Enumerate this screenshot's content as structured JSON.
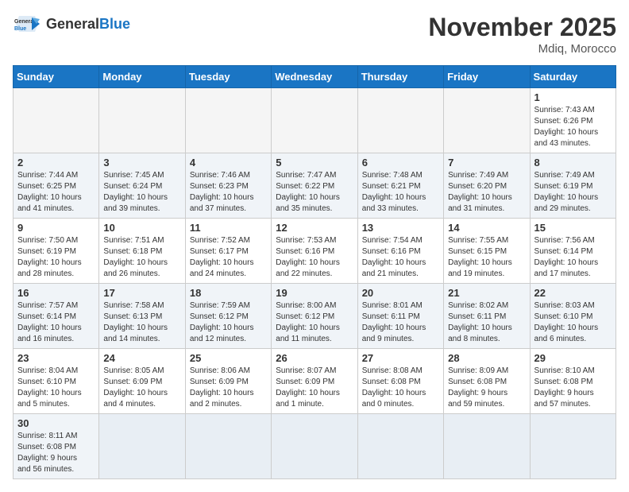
{
  "header": {
    "logo_general": "General",
    "logo_blue": "Blue",
    "month_title": "November 2025",
    "subtitle": "Mdiq, Morocco"
  },
  "weekdays": [
    "Sunday",
    "Monday",
    "Tuesday",
    "Wednesday",
    "Thursday",
    "Friday",
    "Saturday"
  ],
  "weeks": [
    [
      {
        "day": "",
        "info": ""
      },
      {
        "day": "",
        "info": ""
      },
      {
        "day": "",
        "info": ""
      },
      {
        "day": "",
        "info": ""
      },
      {
        "day": "",
        "info": ""
      },
      {
        "day": "",
        "info": ""
      },
      {
        "day": "1",
        "info": "Sunrise: 7:43 AM\nSunset: 6:26 PM\nDaylight: 10 hours\nand 43 minutes."
      }
    ],
    [
      {
        "day": "2",
        "info": "Sunrise: 7:44 AM\nSunset: 6:25 PM\nDaylight: 10 hours\nand 41 minutes."
      },
      {
        "day": "3",
        "info": "Sunrise: 7:45 AM\nSunset: 6:24 PM\nDaylight: 10 hours\nand 39 minutes."
      },
      {
        "day": "4",
        "info": "Sunrise: 7:46 AM\nSunset: 6:23 PM\nDaylight: 10 hours\nand 37 minutes."
      },
      {
        "day": "5",
        "info": "Sunrise: 7:47 AM\nSunset: 6:22 PM\nDaylight: 10 hours\nand 35 minutes."
      },
      {
        "day": "6",
        "info": "Sunrise: 7:48 AM\nSunset: 6:21 PM\nDaylight: 10 hours\nand 33 minutes."
      },
      {
        "day": "7",
        "info": "Sunrise: 7:49 AM\nSunset: 6:20 PM\nDaylight: 10 hours\nand 31 minutes."
      },
      {
        "day": "8",
        "info": "Sunrise: 7:49 AM\nSunset: 6:19 PM\nDaylight: 10 hours\nand 29 minutes."
      }
    ],
    [
      {
        "day": "9",
        "info": "Sunrise: 7:50 AM\nSunset: 6:19 PM\nDaylight: 10 hours\nand 28 minutes."
      },
      {
        "day": "10",
        "info": "Sunrise: 7:51 AM\nSunset: 6:18 PM\nDaylight: 10 hours\nand 26 minutes."
      },
      {
        "day": "11",
        "info": "Sunrise: 7:52 AM\nSunset: 6:17 PM\nDaylight: 10 hours\nand 24 minutes."
      },
      {
        "day": "12",
        "info": "Sunrise: 7:53 AM\nSunset: 6:16 PM\nDaylight: 10 hours\nand 22 minutes."
      },
      {
        "day": "13",
        "info": "Sunrise: 7:54 AM\nSunset: 6:16 PM\nDaylight: 10 hours\nand 21 minutes."
      },
      {
        "day": "14",
        "info": "Sunrise: 7:55 AM\nSunset: 6:15 PM\nDaylight: 10 hours\nand 19 minutes."
      },
      {
        "day": "15",
        "info": "Sunrise: 7:56 AM\nSunset: 6:14 PM\nDaylight: 10 hours\nand 17 minutes."
      }
    ],
    [
      {
        "day": "16",
        "info": "Sunrise: 7:57 AM\nSunset: 6:14 PM\nDaylight: 10 hours\nand 16 minutes."
      },
      {
        "day": "17",
        "info": "Sunrise: 7:58 AM\nSunset: 6:13 PM\nDaylight: 10 hours\nand 14 minutes."
      },
      {
        "day": "18",
        "info": "Sunrise: 7:59 AM\nSunset: 6:12 PM\nDaylight: 10 hours\nand 12 minutes."
      },
      {
        "day": "19",
        "info": "Sunrise: 8:00 AM\nSunset: 6:12 PM\nDaylight: 10 hours\nand 11 minutes."
      },
      {
        "day": "20",
        "info": "Sunrise: 8:01 AM\nSunset: 6:11 PM\nDaylight: 10 hours\nand 9 minutes."
      },
      {
        "day": "21",
        "info": "Sunrise: 8:02 AM\nSunset: 6:11 PM\nDaylight: 10 hours\nand 8 minutes."
      },
      {
        "day": "22",
        "info": "Sunrise: 8:03 AM\nSunset: 6:10 PM\nDaylight: 10 hours\nand 6 minutes."
      }
    ],
    [
      {
        "day": "23",
        "info": "Sunrise: 8:04 AM\nSunset: 6:10 PM\nDaylight: 10 hours\nand 5 minutes."
      },
      {
        "day": "24",
        "info": "Sunrise: 8:05 AM\nSunset: 6:09 PM\nDaylight: 10 hours\nand 4 minutes."
      },
      {
        "day": "25",
        "info": "Sunrise: 8:06 AM\nSunset: 6:09 PM\nDaylight: 10 hours\nand 2 minutes."
      },
      {
        "day": "26",
        "info": "Sunrise: 8:07 AM\nSunset: 6:09 PM\nDaylight: 10 hours\nand 1 minute."
      },
      {
        "day": "27",
        "info": "Sunrise: 8:08 AM\nSunset: 6:08 PM\nDaylight: 10 hours\nand 0 minutes."
      },
      {
        "day": "28",
        "info": "Sunrise: 8:09 AM\nSunset: 6:08 PM\nDaylight: 9 hours\nand 59 minutes."
      },
      {
        "day": "29",
        "info": "Sunrise: 8:10 AM\nSunset: 6:08 PM\nDaylight: 9 hours\nand 57 minutes."
      }
    ],
    [
      {
        "day": "30",
        "info": "Sunrise: 8:11 AM\nSunset: 6:08 PM\nDaylight: 9 hours\nand 56 minutes."
      },
      {
        "day": "",
        "info": ""
      },
      {
        "day": "",
        "info": ""
      },
      {
        "day": "",
        "info": ""
      },
      {
        "day": "",
        "info": ""
      },
      {
        "day": "",
        "info": ""
      },
      {
        "day": "",
        "info": ""
      }
    ]
  ]
}
